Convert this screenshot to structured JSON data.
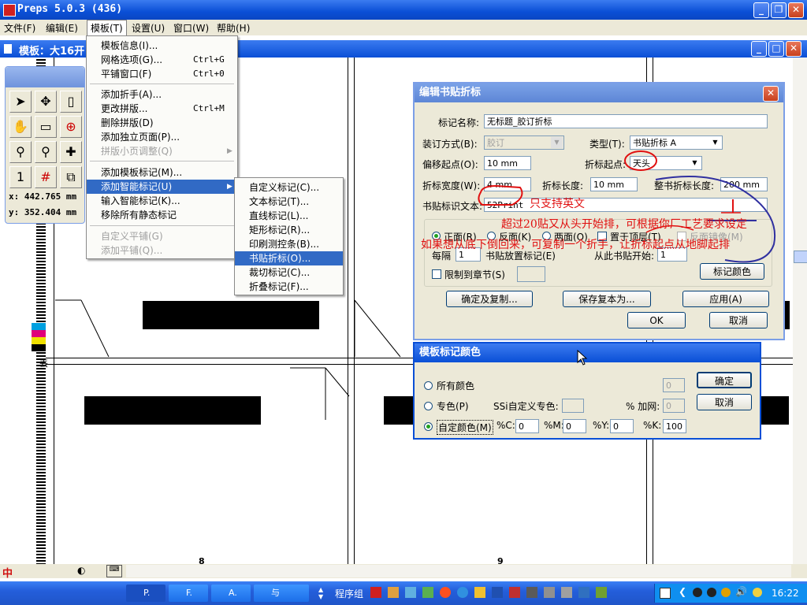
{
  "app": {
    "title": "Preps 5.0.3 (436)",
    "menus": [
      "文件(F)",
      "编辑(E)",
      "模板(T)",
      "设置(U)",
      "窗口(W)",
      "帮助(H)"
    ]
  },
  "doc_window": {
    "title": "模板：大16开"
  },
  "toolbox": {
    "coord_x": "x: 442.765 mm",
    "coord_y": "y: 352.404 mm",
    "tools": [
      "arrow-icon",
      "move-icon",
      "page-icon",
      "hand-icon",
      "marks-icon",
      "register-icon",
      "zoom-icon",
      "zoom-page-icon",
      "cross-icon",
      "one-icon",
      "grid-icon",
      "multi-icon"
    ]
  },
  "template_menu": {
    "items": [
      {
        "label": "模板信息(I)...",
        "shortcut": "",
        "disabled": false
      },
      {
        "label": "网格选项(G)...",
        "shortcut": "Ctrl+G",
        "disabled": false
      },
      {
        "label": "平铺窗口(F)",
        "shortcut": "Ctrl+0",
        "disabled": false
      },
      {
        "label": "添加折手(A)...",
        "shortcut": "",
        "disabled": false
      },
      {
        "label": "更改拼版...",
        "shortcut": "Ctrl+M",
        "disabled": false
      },
      {
        "label": "删除拼版(D)",
        "shortcut": "",
        "disabled": false
      },
      {
        "label": "添加独立页面(P)...",
        "shortcut": "",
        "disabled": false
      },
      {
        "label": "拼版小页调整(Q)",
        "shortcut": "",
        "disabled": true
      },
      {
        "label": "添加模板标记(M)...",
        "shortcut": "",
        "disabled": false
      },
      {
        "label": "添加智能标记(U)",
        "shortcut": "",
        "disabled": false
      },
      {
        "label": "输入智能标记(K)...",
        "shortcut": "",
        "disabled": false
      },
      {
        "label": "移除所有静态标记",
        "shortcut": "",
        "disabled": false
      },
      {
        "label": "自定义平铺(G)",
        "shortcut": "",
        "disabled": true
      },
      {
        "label": "添加平铺(Q)...",
        "shortcut": "",
        "disabled": true
      }
    ]
  },
  "smart_marks_submenu": {
    "items": [
      "自定义标记(C)...",
      "文本标记(T)...",
      "直线标记(L)...",
      "矩形标记(R)...",
      "印刷测控条(B)...",
      "书贴折标(O)...",
      "裁切标记(C)...",
      "折叠标记(F)..."
    ]
  },
  "edit_fold_dialog": {
    "title": "编辑书贴折标",
    "mark_name_label": "标记名称:",
    "mark_name": "无标题_胶订折标",
    "binding_label": "装订方式(B):",
    "binding_value": "胶订",
    "type_label": "类型(T):",
    "type_value": "书贴折标 A",
    "offset_label": "偏移起点(O):",
    "offset_value": "10 mm",
    "fold_start_label": "折标起点:",
    "fold_start_value": "天头",
    "fold_width_label": "折标宽度(W):",
    "fold_width_value": "4 mm",
    "fold_length_label": "折标长度:",
    "fold_length_value": "10 mm",
    "book_length_label": "整书折标长度:",
    "book_length_value": "200 mm",
    "id_text_label": "书贴标识文本:",
    "id_text_value": "52Print",
    "front_label": "正面(R)",
    "back_label": "反面(K)",
    "both_label": "两面(O)",
    "top_label": "置于顶层(T)",
    "mirror_label": "反面镜像(M)",
    "every_label": "每隔",
    "every_value": "1",
    "sig_label": "书贴放置标记(E)",
    "start_from_label": "从此书贴开始:",
    "start_from_value": "1",
    "limit_label": "限制到章节(S)",
    "mark_color_button": "标记颜色",
    "confirm_copy_button": "确定及复制...",
    "save_copy_button": "保存复本为...",
    "apply_button": "应用(A)",
    "ok_button": "OK",
    "cancel_button": "取消"
  },
  "annotations": {
    "english_only": "只支持英文",
    "restart_note": "超过20贴又从头开始排，可根据你厂工艺要求设定",
    "copy_note": "如果想从底下倒回来，可复制一个折手，让折标起点从地脚起排"
  },
  "color_dialog": {
    "title": "模板标记颜色",
    "all_colors_label": "所有颜色",
    "spot_label": "专色(P)",
    "ssi_label": "SSi自定义专色:",
    "screen_label": "% 加网:",
    "custom_label": "自定颜色(M)",
    "c_label": "%C:",
    "c_value": "0",
    "m_label": "%M:",
    "m_value": "0",
    "y_label": "%Y:",
    "y_value": "0",
    "k_label": "%K:",
    "k_value": "100",
    "all_value": "0",
    "screen_value": "0",
    "ok_button": "确定",
    "cancel_button": "取消"
  },
  "canvas": {
    "page_num_left": "8",
    "page_num_right": "9",
    "side_mark": "丟"
  },
  "taskbar": {
    "buttons": [
      "P.",
      "F.",
      "A.",
      "与"
    ],
    "group_label": "程序组",
    "clock": "16:22"
  },
  "colors": {
    "accent": "#0a4fd6",
    "taskbar": "#245edb",
    "annotation": "#e01010",
    "selected": "#316ac5"
  }
}
